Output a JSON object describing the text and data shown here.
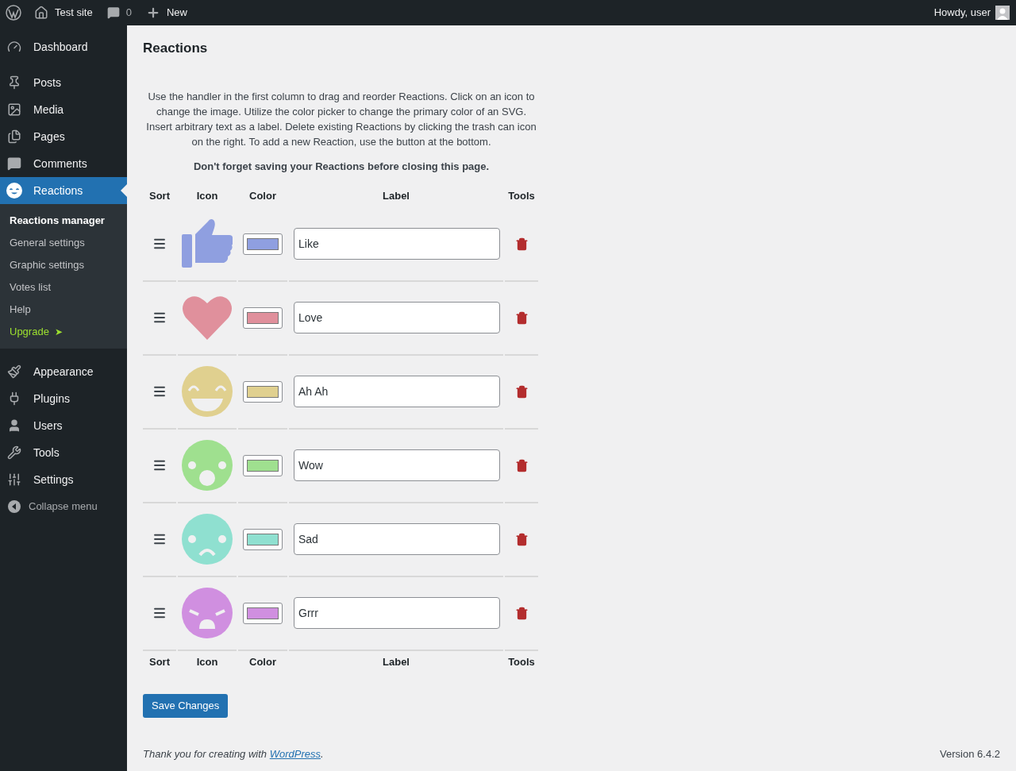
{
  "admin_bar": {
    "site": "Test site",
    "comments": "0",
    "new": "New",
    "greeting": "Howdy, user"
  },
  "sidebar": {
    "items": [
      {
        "label": "Dashboard",
        "kind": "dashboard",
        "selected": false
      },
      {
        "label": "Posts",
        "kind": "posts",
        "selected": false
      },
      {
        "label": "Media",
        "kind": "media",
        "selected": false
      },
      {
        "label": "Pages",
        "kind": "pages",
        "selected": false
      },
      {
        "label": "Comments",
        "kind": "comments",
        "selected": false
      },
      {
        "label": "Reactions",
        "kind": "reactions",
        "selected": true,
        "children": [
          {
            "label": "Reactions manager",
            "kind": "link",
            "selected": true
          },
          {
            "label": "General settings",
            "kind": "link",
            "selected": false
          },
          {
            "label": "Graphic settings",
            "kind": "link",
            "selected": false
          },
          {
            "label": "Votes list",
            "kind": "link",
            "selected": false
          },
          {
            "label": "Help",
            "kind": "link",
            "selected": false
          },
          {
            "label": "Upgrade",
            "kind": "upgrade",
            "arrow": "➤"
          }
        ]
      },
      {
        "label": "Appearance",
        "kind": "appearance",
        "selected": false
      },
      {
        "label": "Plugins",
        "kind": "plugins",
        "selected": false
      },
      {
        "label": "Users",
        "kind": "users",
        "selected": false
      },
      {
        "label": "Tools",
        "kind": "tools",
        "selected": false
      },
      {
        "label": "Settings",
        "kind": "settings",
        "selected": false
      }
    ],
    "collapse": "Collapse menu"
  },
  "page": {
    "title": "Reactions",
    "intro": "Use the handler in the first column to drag and reorder Reactions. Click on an icon to change the image. Utilize the color picker to change the primary color of an SVG. Insert arbitrary text as a label. Delete existing Reactions by clicking the trash can icon on the right. To add a new Reaction, use the button at the bottom.",
    "warning": "Don't forget saving your Reactions before closing this page.",
    "columns": [
      "Sort",
      "Icon",
      "Color",
      "Label",
      "Tools"
    ],
    "reactions": [
      {
        "kind": "like",
        "color": "#8f9fe0",
        "label": "Like"
      },
      {
        "kind": "love",
        "color": "#e0909c",
        "label": "Love"
      },
      {
        "kind": "haha",
        "color": "#e0d08f",
        "label": "Ah Ah"
      },
      {
        "kind": "wow",
        "color": "#9fe08f",
        "label": "Wow"
      },
      {
        "kind": "sad",
        "color": "#8fe0d0",
        "label": "Sad"
      },
      {
        "kind": "angry",
        "color": "#d08fe0",
        "label": "Grrr"
      }
    ],
    "footer_columns": [
      "Sort",
      "Icon",
      "Color",
      "Label",
      "Tools"
    ],
    "save": "Save Changes"
  },
  "footer": {
    "before": "Thank you for creating with ",
    "link": "WordPress",
    "after": ".",
    "version": "Version 6.4.2"
  }
}
